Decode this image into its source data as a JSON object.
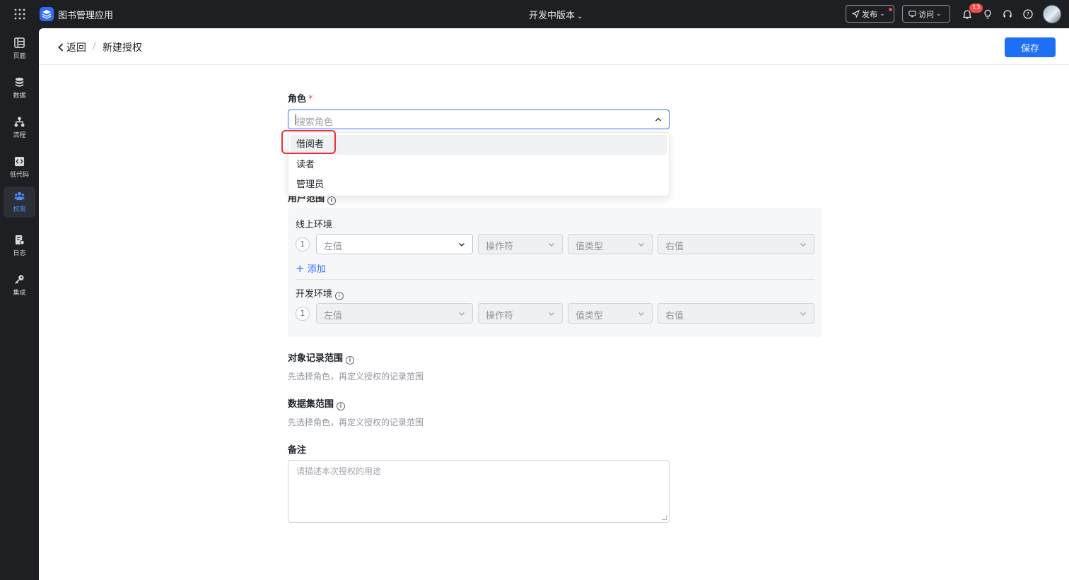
{
  "topbar": {
    "app_name": "图书管理应用",
    "version_label": "开发中版本",
    "publish_label": "发布",
    "visit_label": "访问",
    "notification_count": "13"
  },
  "rail": {
    "items": [
      {
        "label": "页面",
        "icon": "page-icon"
      },
      {
        "label": "数据",
        "icon": "database-icon"
      },
      {
        "label": "流程",
        "icon": "flow-icon"
      },
      {
        "label": "低代码",
        "icon": "code-icon"
      },
      {
        "label": "权限",
        "icon": "users-icon",
        "active": true
      },
      {
        "label": "日志",
        "icon": "log-icon"
      },
      {
        "label": "集成",
        "icon": "key-icon"
      }
    ]
  },
  "header": {
    "back_label": "返回",
    "separator": "/",
    "title": "新建授权",
    "save_label": "保存"
  },
  "form": {
    "role": {
      "label": "角色",
      "required_mark": "*",
      "placeholder": "搜索角色",
      "options": [
        "借阅者",
        "读者",
        "管理员"
      ],
      "hovered_option": "借阅者"
    },
    "user_range": {
      "label": "用户范围",
      "online_env": {
        "title": "线上环境",
        "index": "1",
        "left_value": "左值",
        "operator": "操作符",
        "value_type": "值类型",
        "right_value": "右值",
        "add_label": "添加"
      },
      "dev_env": {
        "title": "开发环境",
        "index": "1",
        "left_value": "左值",
        "operator": "操作符",
        "value_type": "值类型",
        "right_value": "右值"
      }
    },
    "record_scope": {
      "label": "对象记录范围",
      "hint": "先选择角色，再定义授权的记录范围"
    },
    "dataset_scope": {
      "label": "数据集范围",
      "hint": "先选择角色，再定义授权的记录范围"
    },
    "remark": {
      "label": "备注",
      "placeholder": "请描述本次授权的用途"
    }
  },
  "colors": {
    "primary": "#1d6ff5",
    "active_rail": "#4c8dff",
    "required": "#f54a45",
    "highlight": "#e5323a"
  }
}
